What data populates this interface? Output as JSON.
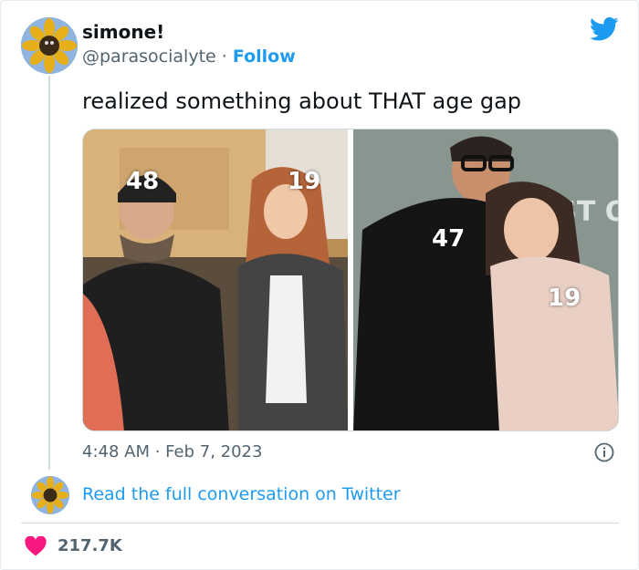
{
  "tweet": {
    "author": {
      "display_name": "simone!",
      "handle": "@parasocialyte",
      "follow_label": "Follow",
      "avatar_icon": "sunflower-avatar"
    },
    "text": "realized something about THAT age gap",
    "media": {
      "left_photo": {
        "labels": [
          "48",
          "19"
        ]
      },
      "right_photo": {
        "labels": [
          "47",
          "19"
        ],
        "backdrop_text": "AST OF US"
      }
    },
    "timestamp": "4:48 AM · Feb 7, 2023",
    "read_more": "Read the full conversation on Twitter",
    "likes": "217.7K"
  },
  "icons": {
    "brand": "twitter-bird-icon",
    "info": "info-icon",
    "like": "heart-icon"
  },
  "colors": {
    "accent": "#1d9bf0",
    "heart": "#f91880",
    "secondary_text": "#536471"
  }
}
